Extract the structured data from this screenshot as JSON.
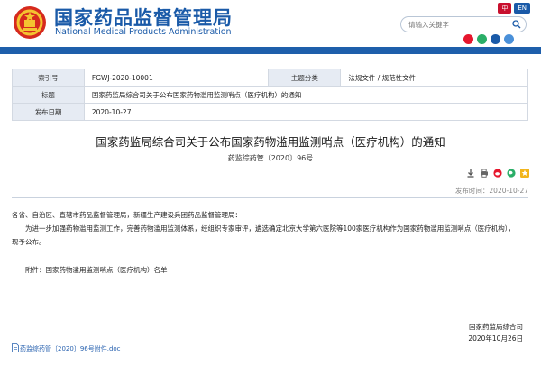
{
  "header": {
    "title_cn": "国家药品监督管理局",
    "title_en": "National Medical Products Administration",
    "lang": [
      "中",
      "EN"
    ],
    "search_placeholder": "请输入关键字",
    "social_icons": [
      "weibo-icon",
      "wechat-icon",
      "app-icon",
      "mobile-icon"
    ],
    "colors": {
      "brand": "#1a5aa8",
      "bar": "#1e5fab",
      "accent": "#c8102e"
    }
  },
  "meta": {
    "rows": [
      {
        "k1": "索引号",
        "v1": "FGWJ-2020-10001",
        "k2": "主题分类",
        "v2": "法规文件 / 规范性文件"
      },
      {
        "k1": "标题",
        "v1": "国家药监局综合司关于公布国家药物滥用监测哨点（医疗机构）的通知"
      },
      {
        "k1": "发布日期",
        "v1": "2020-10-27"
      }
    ]
  },
  "article": {
    "title": "国家药监局综合司关于公布国家药物滥用监测哨点（医疗机构）的通知",
    "doc_number": "药监综药管〔2020〕96号",
    "publish_date": "发布时间：2020-10-27",
    "salutation": "各省、自治区、直辖市药品监督管理局，新疆生产建设兵团药品监督管理局：",
    "body_line1": "为进一步加强药物滥用监测工作，完善药物滥用监测体系，经组织专家审评，遴选确定北京大学第六医院等100家医疗机构作为国家药物滥用监测哨点（医疗机构），",
    "body_line2": "现予公布。",
    "attachment_label": "附件：国家药物滥用监测哨点（医疗机构）名单",
    "signature_org": "国家药监局综合司",
    "signature_date": "2020年10月26日",
    "attachment_file": "药监综药管〔2020〕96号附件.doc"
  },
  "tool_icons": [
    "download-icon",
    "print-icon",
    "weibo-share-icon",
    "wechat-share-icon",
    "favorite-icon"
  ]
}
